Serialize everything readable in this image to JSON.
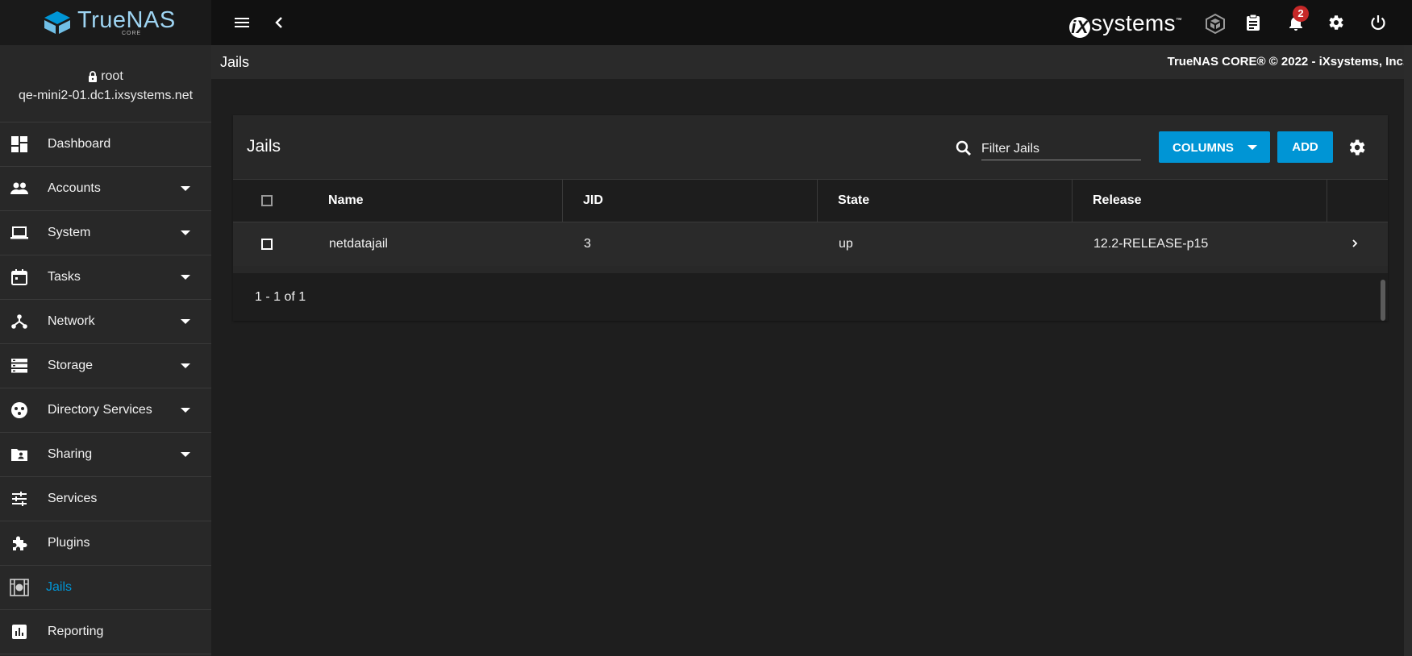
{
  "app": {
    "logo_text": "TrueNAS",
    "logo_sub": "CORE"
  },
  "user": {
    "name": "root",
    "host": "qe-mini2-01.dc1.ixsystems.net"
  },
  "sidebar": {
    "items": [
      {
        "label": "Dashboard",
        "icon": "dashboard-icon",
        "expandable": false,
        "active": false
      },
      {
        "label": "Accounts",
        "icon": "people-icon",
        "expandable": true,
        "active": false
      },
      {
        "label": "System",
        "icon": "laptop-icon",
        "expandable": true,
        "active": false
      },
      {
        "label": "Tasks",
        "icon": "calendar-icon",
        "expandable": true,
        "active": false
      },
      {
        "label": "Network",
        "icon": "network-icon",
        "expandable": true,
        "active": false
      },
      {
        "label": "Storage",
        "icon": "storage-icon",
        "expandable": true,
        "active": false
      },
      {
        "label": "Directory Services",
        "icon": "directory-icon",
        "expandable": true,
        "active": false
      },
      {
        "label": "Sharing",
        "icon": "shared-folder-icon",
        "expandable": true,
        "active": false
      },
      {
        "label": "Services",
        "icon": "tune-icon",
        "expandable": false,
        "active": false
      },
      {
        "label": "Plugins",
        "icon": "puzzle-icon",
        "expandable": false,
        "active": false
      },
      {
        "label": "Jails",
        "icon": "jail-icon",
        "expandable": false,
        "active": true
      },
      {
        "label": "Reporting",
        "icon": "chart-icon",
        "expandable": false,
        "active": false
      }
    ]
  },
  "topbar": {
    "vendor_logo": "systems",
    "notification_count": "2",
    "icons": [
      "menu-icon",
      "back-icon",
      "truecommand-icon",
      "clipboard-icon",
      "bell-icon",
      "gear-icon",
      "power-icon"
    ]
  },
  "page": {
    "breadcrumb": "Jails",
    "copyright": "TrueNAS CORE® © 2022 - iXsystems, Inc."
  },
  "jails": {
    "title": "Jails",
    "filter_placeholder": "Filter Jails",
    "columns_button": "COLUMNS",
    "add_button": "ADD",
    "columns": [
      "Name",
      "JID",
      "State",
      "Release"
    ],
    "rows": [
      {
        "name": "netdatajail",
        "jid": "3",
        "state": "up",
        "release": "12.2-RELEASE-p15"
      }
    ],
    "pagination": "1 - 1 of 1"
  },
  "colors": {
    "accent": "#0095d5",
    "badge": "#c62828",
    "background": "#1e1e1e",
    "sidebar": "#282828"
  }
}
